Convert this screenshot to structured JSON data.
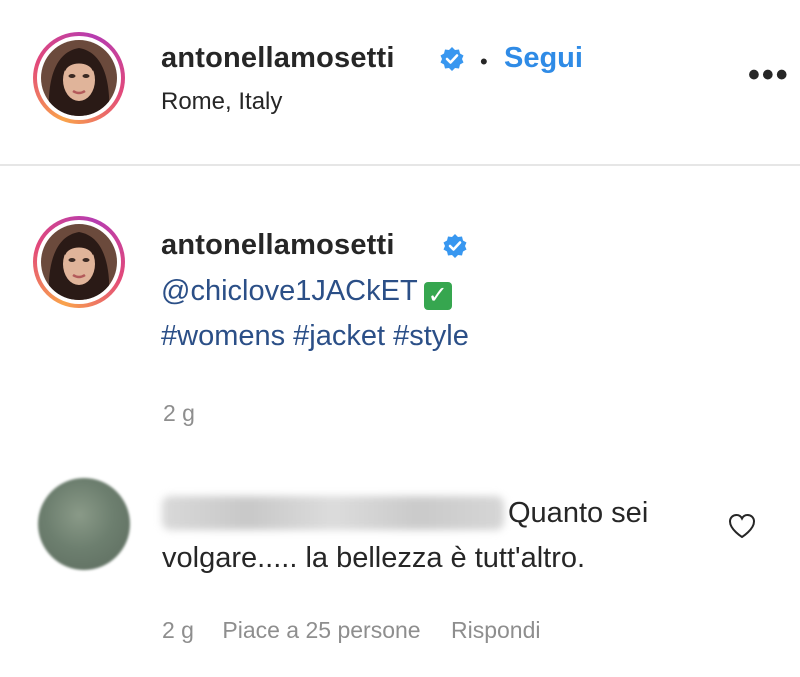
{
  "header": {
    "username": "antonellamosetti",
    "separator": "•",
    "follow_label": "Segui",
    "location": "Rome, Italy",
    "more_label": "•••"
  },
  "caption": {
    "username": "antonellamosetti",
    "mention": "@chiclove1JACkET",
    "mention_emoji": "✓",
    "hashtags": "#womens #jacket #style",
    "time": "2 g"
  },
  "comment": {
    "text_line1": "Quanto sei",
    "text_line2": "volgare..... la bellezza è tutt'altro.",
    "time": "2 g",
    "likes": "Piace a 25 persone",
    "reply_label": "Rispondi"
  },
  "colors": {
    "verified": "#3897f0",
    "link": "#2f8be6",
    "hashtag": "#2b4f87",
    "meta": "#8e8e8e"
  }
}
